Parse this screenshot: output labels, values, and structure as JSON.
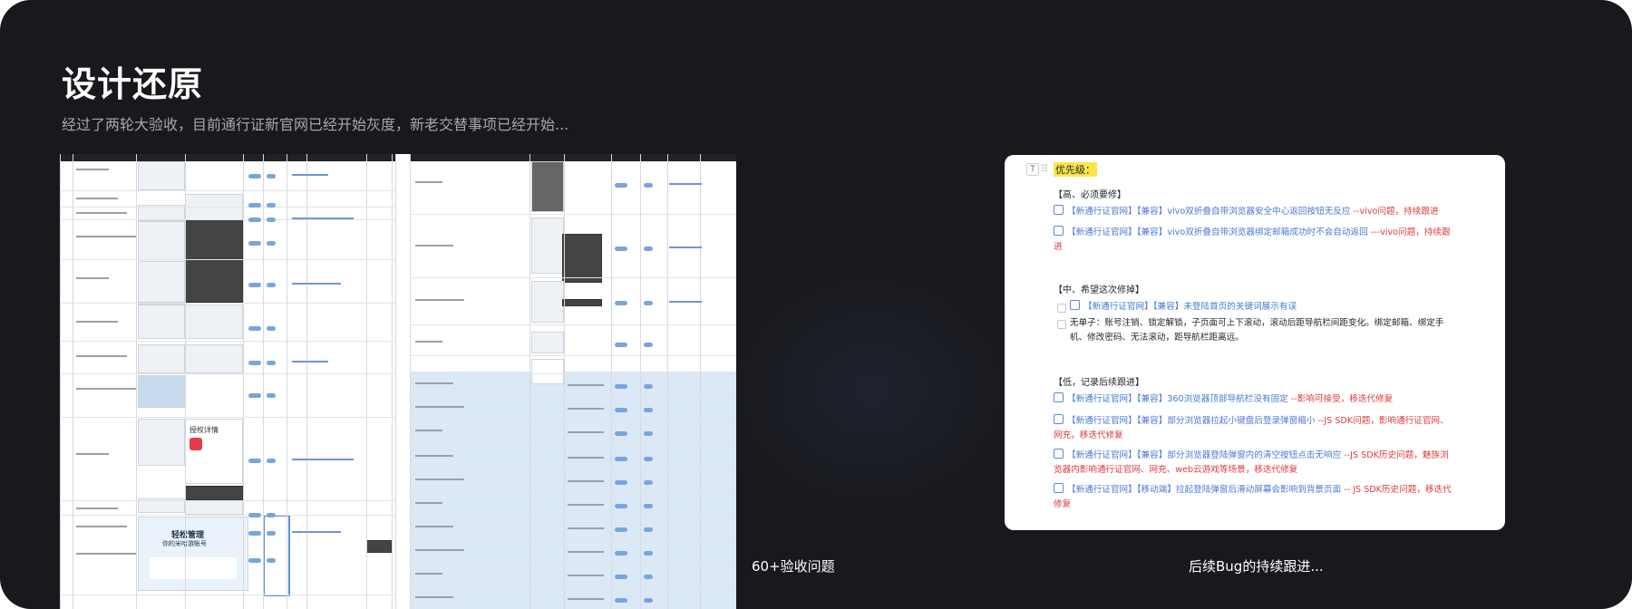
{
  "header": {
    "title": "设计还原",
    "subtitle": "经过了两轮大验收，目前通行证新官网已经开始灰度，新老交替事项已经开始..."
  },
  "panels": {
    "left_caption": "60+验收问题",
    "right_caption": "后续Bug的持续跟进..."
  },
  "doc": {
    "priority_label": "优先级：",
    "sections": [
      {
        "heading": "【高、必须要修】",
        "items": [
          {
            "blue": "【新通行证官网】【兼容】vivo双折叠自带浏览器安全中心返回按钮无反应",
            "red": " --vivo问题，持续跟进"
          },
          {
            "blue": "【新通行证官网】【兼容】vivo双折叠自带浏览器绑定邮箱成功时不会自动返回",
            "red": " ---vivo问题，持续跟进"
          }
        ]
      },
      {
        "heading": "【中、希望这次修掉】",
        "items": [
          {
            "blue": "【新通行证官网】【兼容】未登陆首页的关键词展示有误",
            "red": ""
          },
          {
            "plain": "无单子：账号注销、锁定解锁，子页面可上下滚动，滚动后距导航栏间距变化。绑定邮箱、绑定手机、修改密码、无法滚动，距导航栏距离远。"
          }
        ]
      },
      {
        "heading": "【低，记录后续跟进】",
        "items": [
          {
            "blue": "【新通行证官网】【兼容】360浏览器顶部导航栏没有固定",
            "red": " --影响可接受，移迭代修复"
          },
          {
            "blue": "【新通行证官网】【兼容】部分浏览器拉起小键盘后登录弹窗缩小",
            "red": " --JS SDK问题，影响通行证官网、网充，移迭代修复"
          },
          {
            "blue": "【新通行证官网】【兼容】部分浏览器登陆弹窗内的清空按钮点击无响应",
            "red": " --JS SDK历史问题，魅族浏览器内影响通行证官网、网充、web云游戏等场景，移迭代修复"
          },
          {
            "blue": "【新通行证官网】【移动端】拉起登陆弹窗后滑动屏幕会影响到背景页面",
            "red": " -- JS SDK历史问题，移迭代修复"
          }
        ]
      }
    ]
  },
  "sheet_snippets": {
    "auth_title": "授权详情",
    "promo_title": "轻松管理",
    "promo_sub": "你的米哈游账号"
  },
  "colors": {
    "background": "#18191c",
    "link_blue": "#4a78d4",
    "issue_red": "#e03a3a",
    "priority_highlight": "#fbe64a"
  }
}
